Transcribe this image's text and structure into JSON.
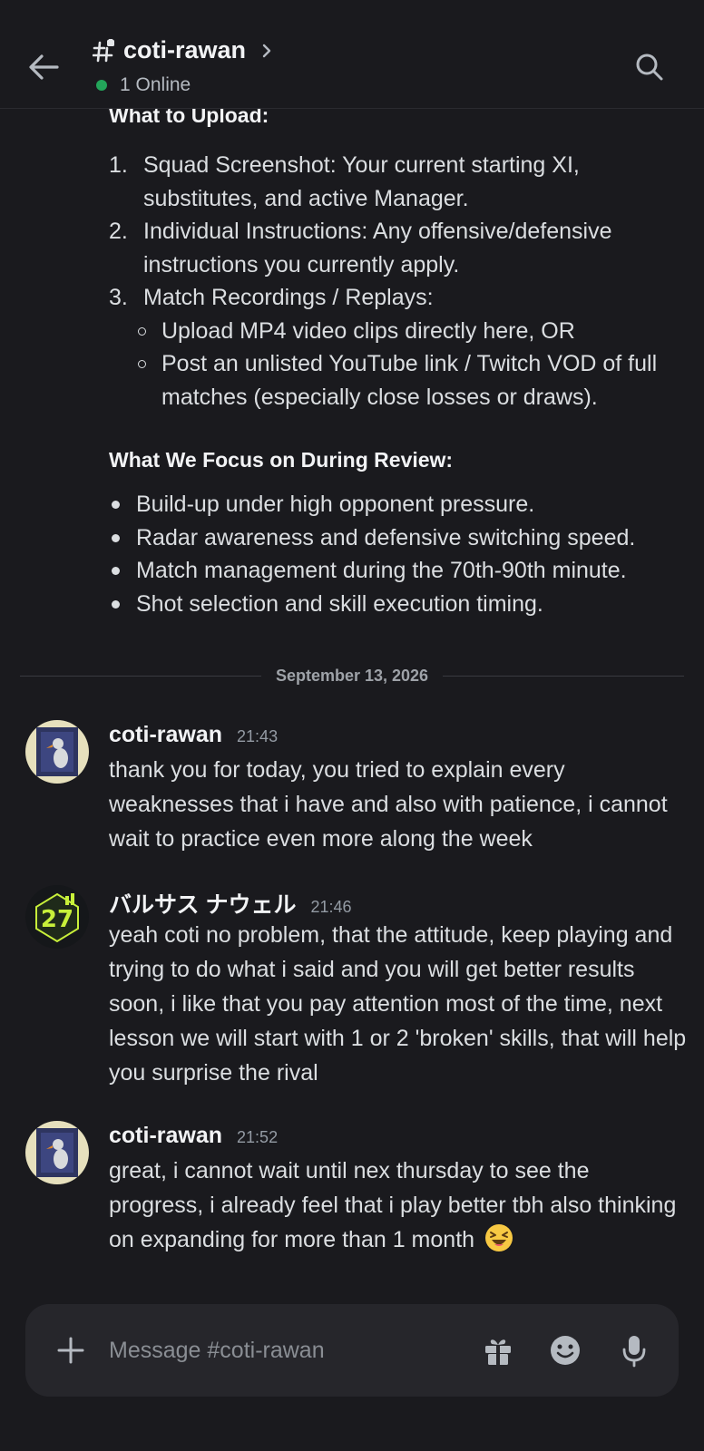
{
  "header": {
    "channel_name": "coti-rawan",
    "online_text": "1 Online"
  },
  "pinned_content": {
    "upload_heading": "What to Upload:",
    "upload_items": [
      {
        "num": "1.",
        "text": "Squad Screenshot: Your current starting XI, substitutes, and active Manager."
      },
      {
        "num": "2.",
        "text": "Individual Instructions: Any offensive/defensive instructions you currently apply."
      },
      {
        "num": "3.",
        "text": "Match Recordings / Replays:"
      }
    ],
    "replay_subitems": [
      "Upload MP4 video clips directly here, OR",
      "Post an unlisted YouTube link / Twitch VOD of full matches (especially close losses or draws)."
    ],
    "focus_heading": "What We Focus on During Review:",
    "focus_items": [
      "Build-up under high opponent pressure.",
      "Radar awareness and defensive switching speed.",
      "Match management during the 70th-90th minute.",
      "Shot selection and skill execution timing."
    ]
  },
  "date_divider": "September 13, 2026",
  "messages": [
    {
      "author": "coti-rawan",
      "time": "21:43",
      "text": "thank you for today, you tried to explain every weaknesses that i have and also with patience, i cannot wait to practice even more along the week"
    },
    {
      "author": "バルサス ナウェル",
      "time": "21:46",
      "text": "yeah coti no problem, that the attitude, keep playing and trying to do what i said and you will get better results soon, i like that you pay attention most of the time, next lesson we will start with 1 or 2 'broken' skills, that will help you surprise the rival"
    },
    {
      "author": "coti-rawan",
      "time": "21:52",
      "text": "great, i cannot wait until nex thursday to see the progress, i already feel that i play better tbh also thinking on expanding for more than 1 month"
    }
  ],
  "composer": {
    "placeholder": "Message #coti-rawan"
  },
  "colors": {
    "background": "#1a1a1e",
    "online": "#23a55a",
    "composer": "#26262b"
  }
}
